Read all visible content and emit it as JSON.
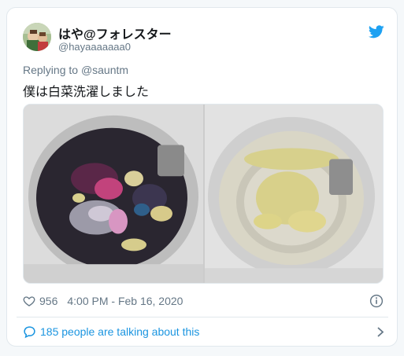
{
  "tweet": {
    "author_name": "はや@フォレスター",
    "author_handle": "@hayaaaaaaa0",
    "reply_prefix": "Replying to",
    "reply_to": "@sauntm",
    "text": "僕は白菜洗濯しました",
    "likes": "956",
    "timestamp": "4:00 PM - Feb 16, 2020",
    "talking": "185 people are talking about this"
  },
  "icons": {
    "brand": "twitter-bird-icon",
    "like": "heart-icon",
    "info": "info-icon",
    "conversation": "speech-bubble-icon",
    "navigate": "chevron-right-icon"
  },
  "colors": {
    "link": "#1b95e0",
    "brand": "#1da1f2",
    "secondary_text": "#657786",
    "border": "#e1e8ed"
  }
}
